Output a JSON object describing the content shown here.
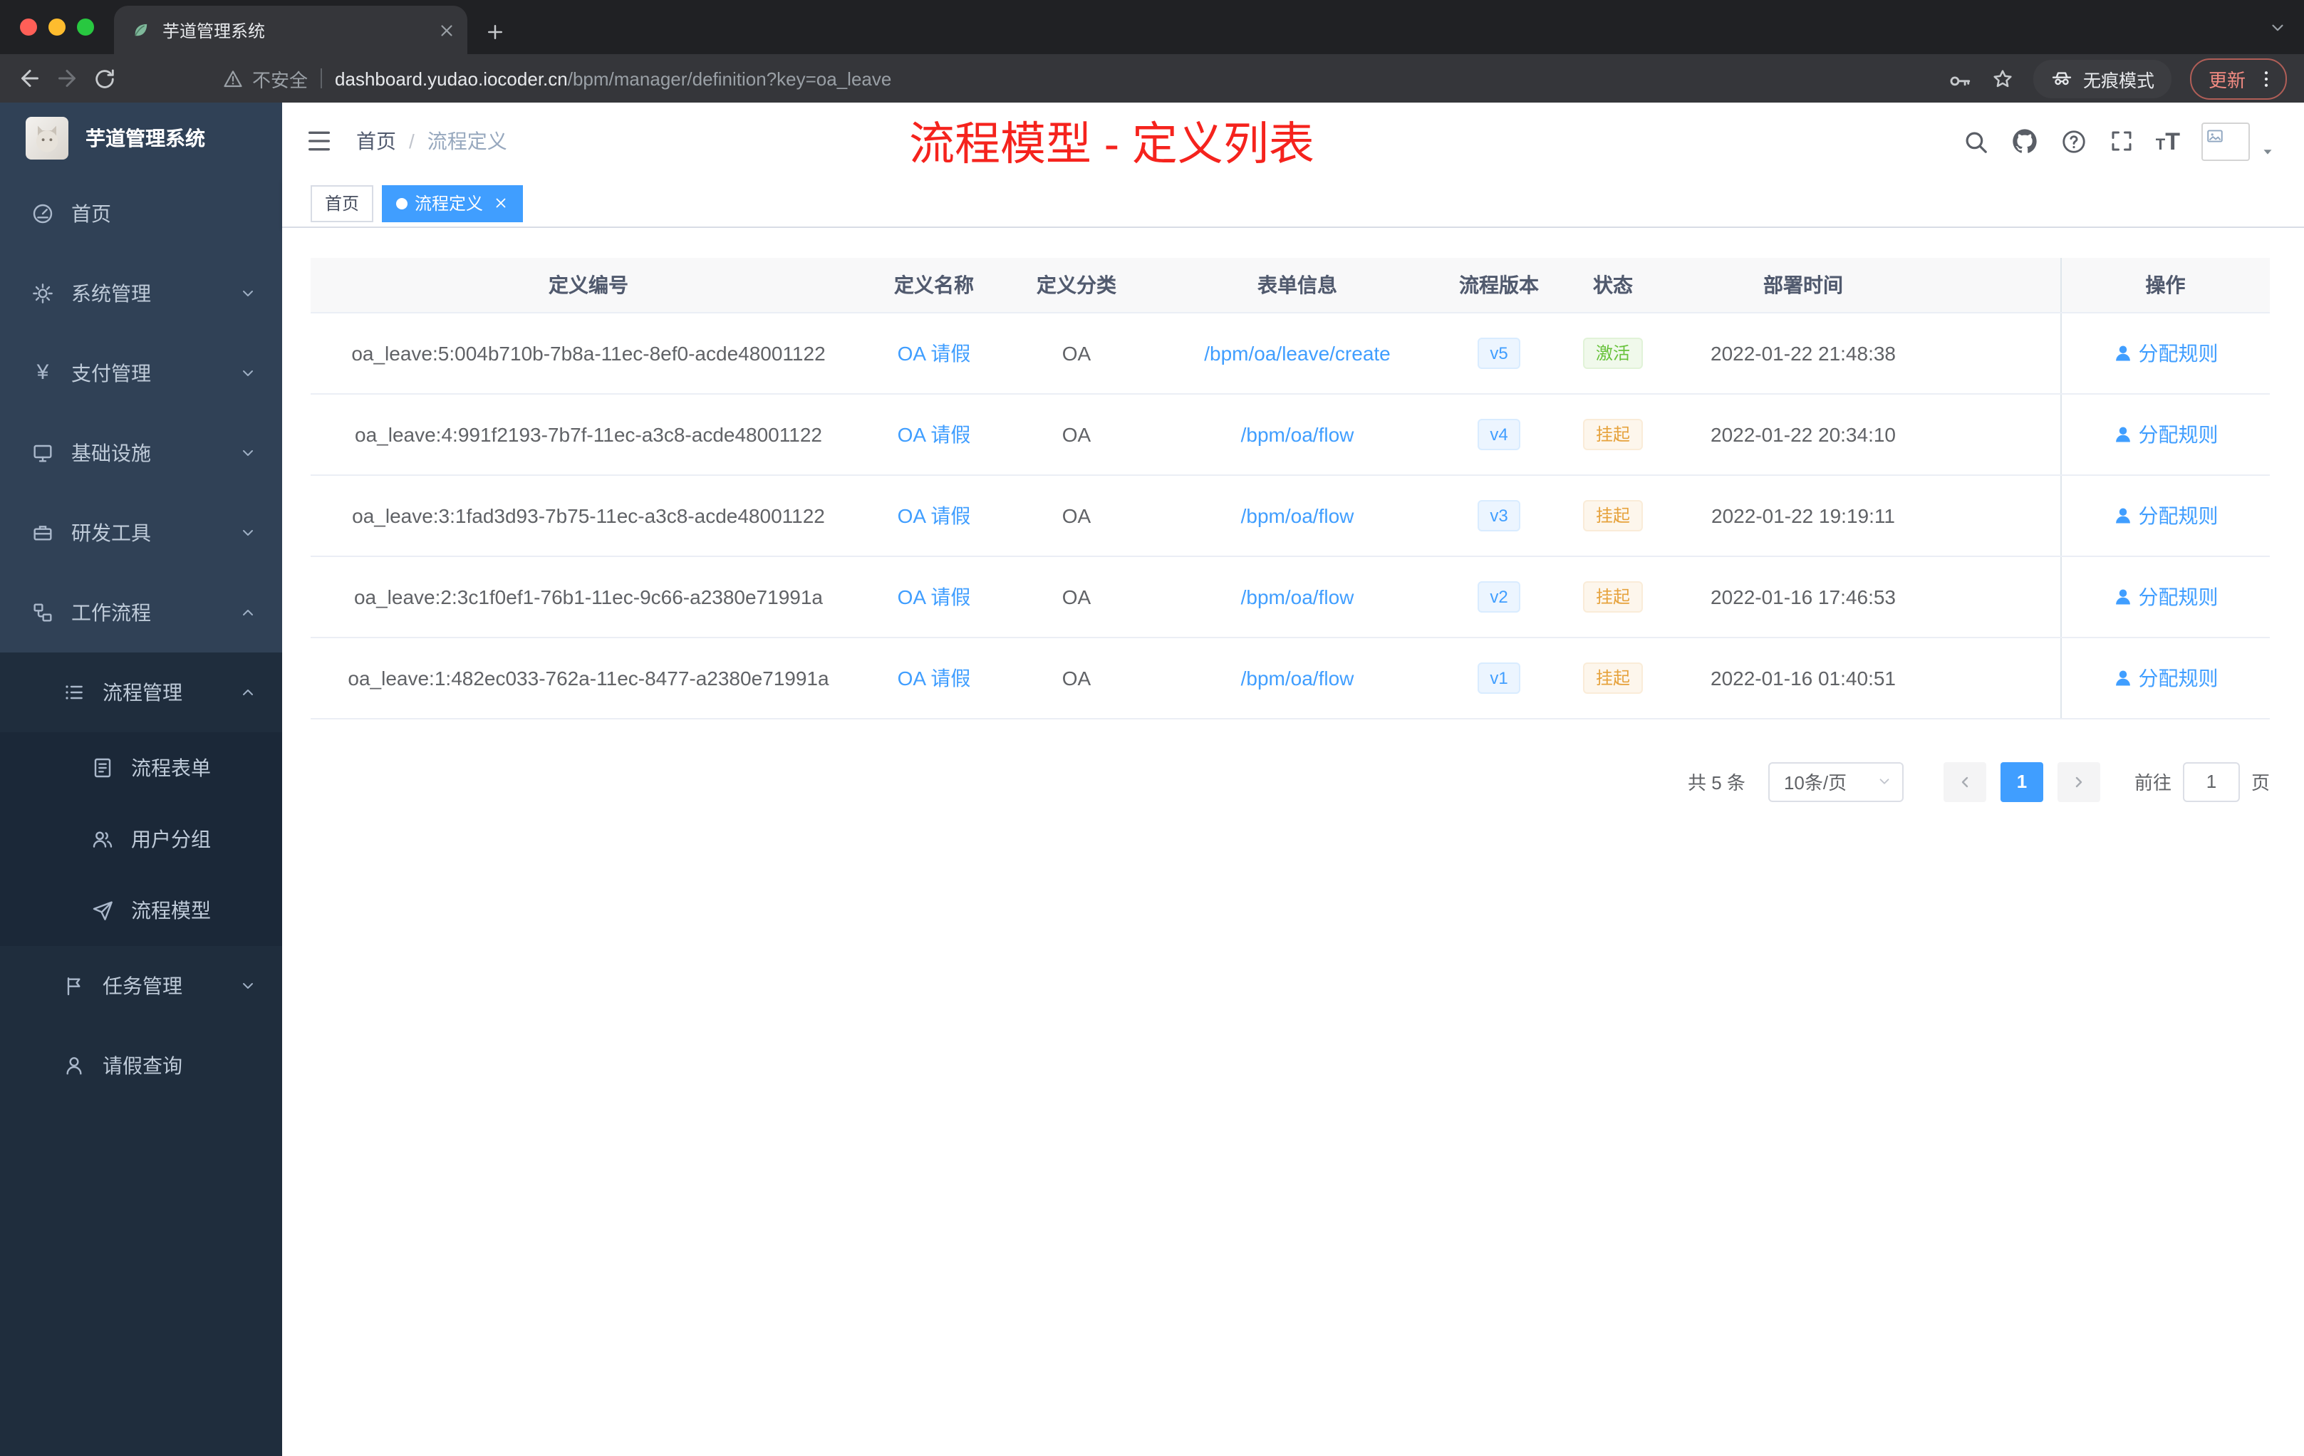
{
  "colors": {
    "accent": "#409eff",
    "success": "#67c23a",
    "warning": "#e6a23c",
    "annotation_red": "#f5231d",
    "sidebar_bg": "#304156",
    "submenu_bg": "#1f2d3d"
  },
  "browser": {
    "tab_title": "芋道管理系统",
    "security_label": "不安全",
    "url_host": "dashboard.yudao.iocoder.cn",
    "url_path": "/bpm/manager/definition?key=oa_leave",
    "incognito_label": "无痕模式",
    "update_label": "更新"
  },
  "sidebar": {
    "logo_title": "芋道管理系统",
    "payment_icon_glyph": "¥",
    "home": "首页",
    "system": "系统管理",
    "payment": "支付管理",
    "infra": "基础设施",
    "devtools": "研发工具",
    "workflow": "工作流程",
    "process_mgmt": "流程管理",
    "process_form": "流程表单",
    "user_group": "用户分组",
    "process_model": "流程模型",
    "task_mgmt": "任务管理",
    "leave_query": "请假查询"
  },
  "navbar": {
    "breadcrumb_home": "首页",
    "breadcrumb_sep": "/",
    "breadcrumb_current": "流程定义",
    "annotation": "流程模型 - 定义列表",
    "font_icon_small": "T",
    "font_icon_large": "T"
  },
  "tags": {
    "home": "首页",
    "current": "流程定义"
  },
  "table": {
    "columns": {
      "id": "定义编号",
      "name": "定义名称",
      "category": "定义分类",
      "form": "表单信息",
      "version": "流程版本",
      "status": "状态",
      "deploy_time": "部署时间",
      "actions": "操作"
    },
    "rows": [
      {
        "id": "oa_leave:5:004b710b-7b8a-11ec-8ef0-acde48001122",
        "name": "OA 请假",
        "category": "OA",
        "form": "/bpm/oa/leave/create",
        "version": "v5",
        "status": "激活",
        "status_type": "success",
        "deploy_time": "2022-01-22 21:48:38",
        "action": "分配规则"
      },
      {
        "id": "oa_leave:4:991f2193-7b7f-11ec-a3c8-acde48001122",
        "name": "OA 请假",
        "category": "OA",
        "form": "/bpm/oa/flow",
        "version": "v4",
        "status": "挂起",
        "status_type": "warning",
        "deploy_time": "2022-01-22 20:34:10",
        "action": "分配规则"
      },
      {
        "id": "oa_leave:3:1fad3d93-7b75-11ec-a3c8-acde48001122",
        "name": "OA 请假",
        "category": "OA",
        "form": "/bpm/oa/flow",
        "version": "v3",
        "status": "挂起",
        "status_type": "warning",
        "deploy_time": "2022-01-22 19:19:11",
        "action": "分配规则"
      },
      {
        "id": "oa_leave:2:3c1f0ef1-76b1-11ec-9c66-a2380e71991a",
        "name": "OA 请假",
        "category": "OA",
        "form": "/bpm/oa/flow",
        "version": "v2",
        "status": "挂起",
        "status_type": "warning",
        "deploy_time": "2022-01-16 17:46:53",
        "action": "分配规则"
      },
      {
        "id": "oa_leave:1:482ec033-762a-11ec-8477-a2380e71991a",
        "name": "OA 请假",
        "category": "OA",
        "form": "/bpm/oa/flow",
        "version": "v1",
        "status": "挂起",
        "status_type": "warning",
        "deploy_time": "2022-01-16 01:40:51",
        "action": "分配规则"
      }
    ]
  },
  "pagination": {
    "total": "共 5 条",
    "page_size": "10条/页",
    "current_page": "1",
    "goto_label": "前往",
    "goto_value": "1",
    "page_unit": "页"
  }
}
